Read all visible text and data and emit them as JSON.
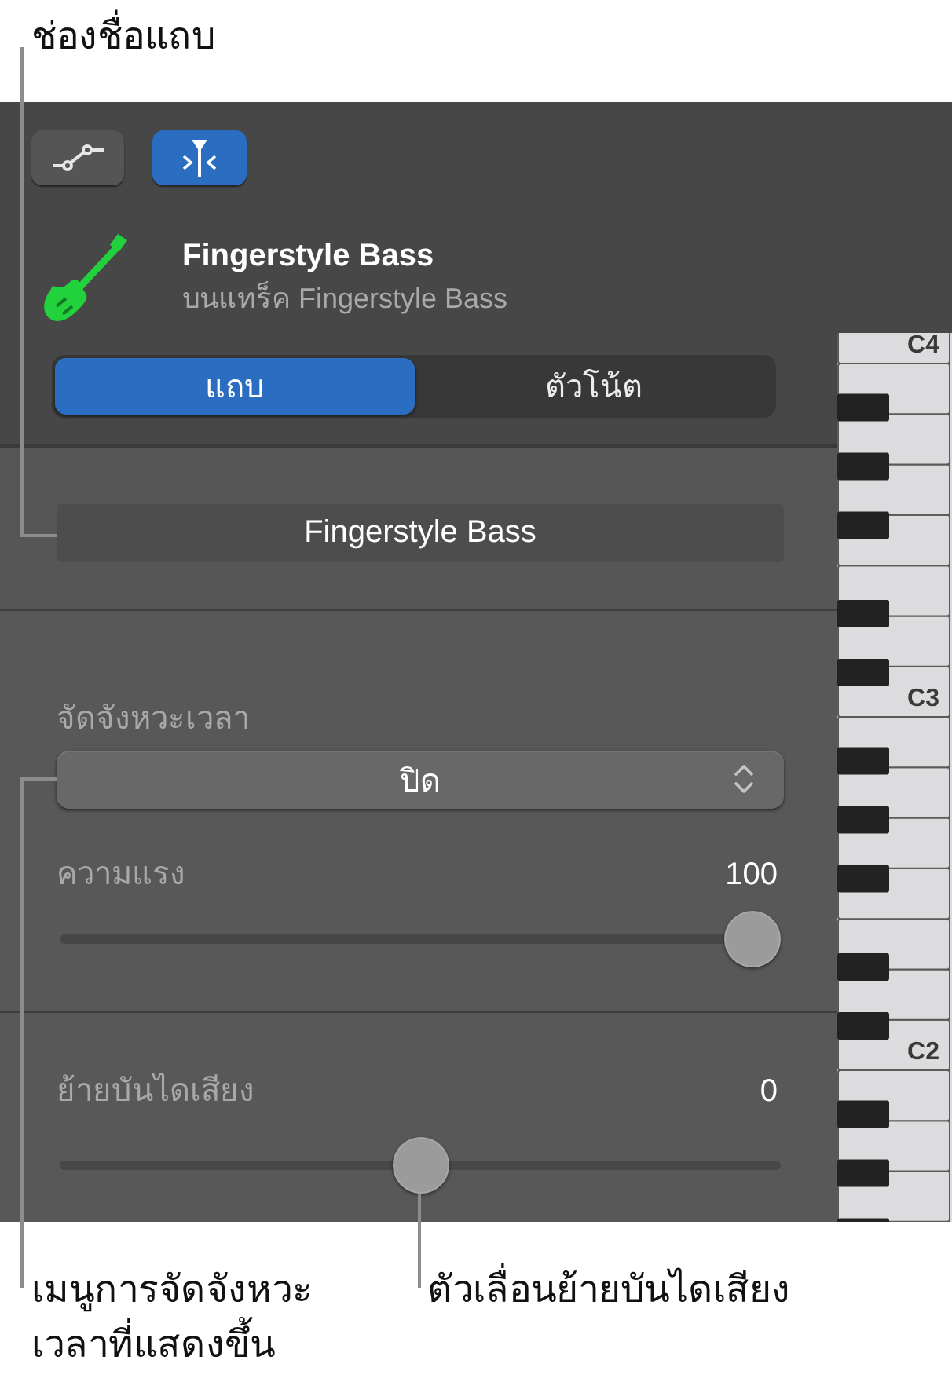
{
  "callout_top": {
    "text": "ช่องชื่อแถบ"
  },
  "toolbar_buttons": [
    {
      "kind": "automation",
      "selected": false
    },
    {
      "kind": "catch",
      "selected": true
    }
  ],
  "track": {
    "name": "Fingerstyle Bass",
    "subtitle": "บนแทร็ค Fingerstyle Bass"
  },
  "segments": [
    {
      "label": "แถบ",
      "selected": true
    },
    {
      "label": "ตัวโน้ต",
      "selected": false
    }
  ],
  "region_name_field": {
    "value": "Fingerstyle Bass"
  },
  "time_quantize": {
    "label": "จัดจังหวะเวลา",
    "value": "ปิด"
  },
  "sliders": [
    {
      "label": "ความแรง",
      "reading": "100",
      "level": 1
    },
    {
      "label": "ย้ายบันไดเสียง",
      "reading": "0",
      "level": 0.5
    }
  ],
  "keyboard": {
    "octave_labels": [
      "C4",
      "C3",
      "C2"
    ]
  },
  "callouts_bottom": [
    {
      "lines": [
        "เมนูการจัดจังหวะ",
        "เวลาที่แสดงขึ้น"
      ]
    },
    {
      "lines": [
        "ตัวเลื่อนย้ายบันไดเสียง"
      ]
    }
  ]
}
